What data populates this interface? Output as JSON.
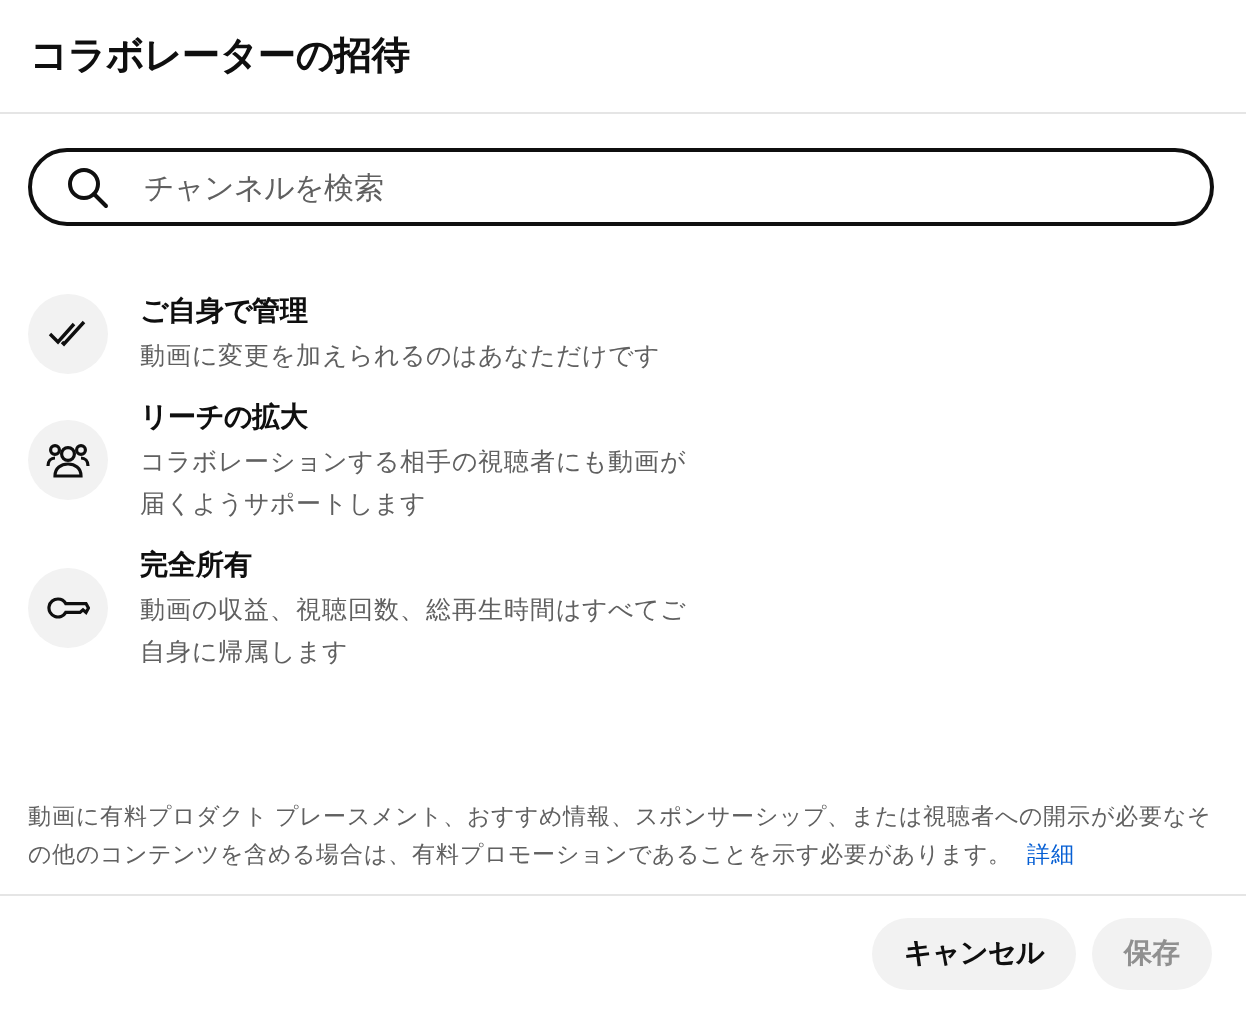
{
  "dialog": {
    "title": "コラボレーターの招待"
  },
  "search": {
    "placeholder": "チャンネルを検索"
  },
  "features": [
    {
      "kind": "check",
      "title": "ご自身で管理",
      "description": "動画に変更を加えられるのはあなただけです"
    },
    {
      "kind": "people",
      "title": "リーチの拡大",
      "description": "コラボレーションする相手の視聴者にも動画が届くようサポートします"
    },
    {
      "kind": "key",
      "title": "完全所有",
      "description": "動画の収益、視聴回数、総再生時間はすべてご自身に帰属します"
    }
  ],
  "notice": {
    "text": "動画に有料プロダクト プレースメント、おすすめ情報、スポンサーシップ、または視聴者への開示が必要なその他のコンテンツを含める場合は、有料プロモーションであることを示す必要があります。",
    "link": "詳細"
  },
  "buttons": [
    {
      "label": "キャンセル",
      "disabled": false
    },
    {
      "label": "保存",
      "disabled": true
    }
  ]
}
